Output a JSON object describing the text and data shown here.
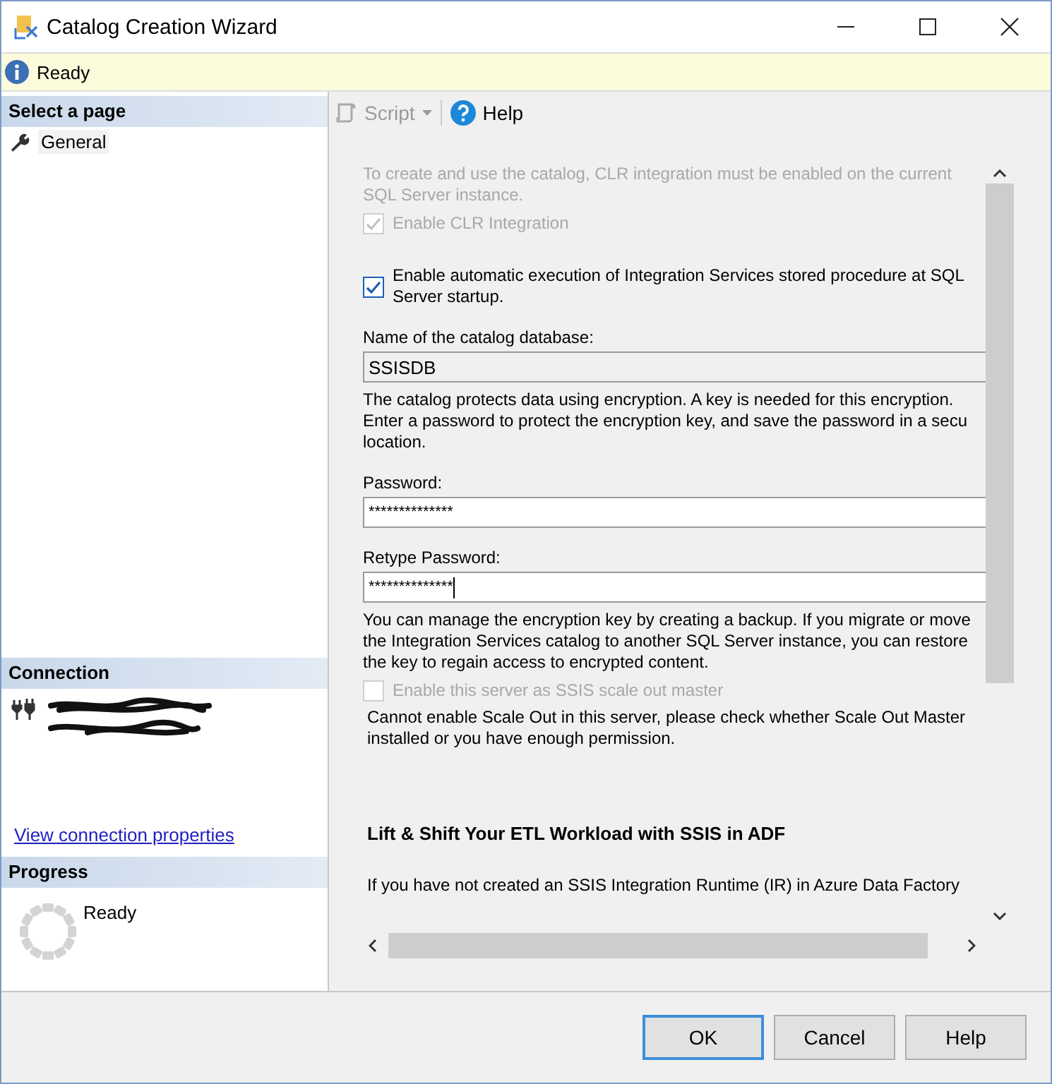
{
  "window": {
    "title": "Catalog Creation Wizard"
  },
  "info_bar": {
    "text": "Ready"
  },
  "sidebar": {
    "header": "Select a page",
    "pages": [
      {
        "label": "General",
        "selected": true
      }
    ],
    "connection": {
      "header": "Connection",
      "link": "View connection properties"
    },
    "progress": {
      "header": "Progress",
      "status": "Ready"
    }
  },
  "toolbar": [
    {
      "kind": "script",
      "label": "Script",
      "disabled": true
    },
    {
      "kind": "help",
      "label": "Help",
      "disabled": false
    }
  ],
  "content": [
    {
      "kind": "note",
      "disabled": true,
      "lines": [
        "To create and use the catalog, CLR integration must be enabled on the current",
        "SQL Server instance."
      ]
    },
    {
      "kind": "checkbox",
      "checked": true,
      "disabled": true,
      "lines": [
        "Enable CLR Integration"
      ]
    },
    {
      "kind": "checkbox",
      "checked": true,
      "disabled": false,
      "lines": [
        "Enable automatic execution of Integration Services stored procedure at SQL",
        "Server startup."
      ]
    },
    {
      "kind": "label",
      "lines": [
        "Name of the catalog database:"
      ]
    },
    {
      "kind": "field",
      "value": "SSISDB",
      "editable": false,
      "focused": false
    },
    {
      "kind": "paragraph",
      "lines": [
        "The catalog protects data using encryption. A key is needed for this encryption.",
        "Enter a password to protect the encryption key, and save the password in a secu",
        "location."
      ]
    },
    {
      "kind": "label",
      "lines": [
        "Password:"
      ]
    },
    {
      "kind": "field",
      "value": "**************",
      "editable": true,
      "focused": false
    },
    {
      "kind": "label",
      "lines": [
        "Retype Password:"
      ]
    },
    {
      "kind": "field",
      "value": "**************",
      "editable": true,
      "focused": true
    },
    {
      "kind": "paragraph",
      "lines": [
        "You can manage the encryption key by creating a backup. If you migrate or move",
        "the Integration Services catalog to another SQL Server instance, you can restore",
        "the key to regain access to encrypted content."
      ]
    },
    {
      "kind": "checkbox",
      "checked": false,
      "disabled": true,
      "lines": [
        "Enable this server as SSIS scale out master"
      ]
    },
    {
      "kind": "note",
      "disabled": false,
      "lines": [
        "Cannot enable Scale Out in this server, please check whether Scale Out Master",
        "installed or you have enough permission."
      ]
    },
    {
      "kind": "heading",
      "lines": [
        "Lift & Shift Your ETL Workload with SSIS in ADF"
      ]
    },
    {
      "kind": "paragraph",
      "lines": [
        "If you have not created an SSIS Integration Runtime (IR) in Azure Data Factory"
      ]
    }
  ],
  "buttons": [
    {
      "label": "OK",
      "default": true
    },
    {
      "label": "Cancel",
      "default": false
    },
    {
      "label": "Help",
      "default": false
    }
  ]
}
